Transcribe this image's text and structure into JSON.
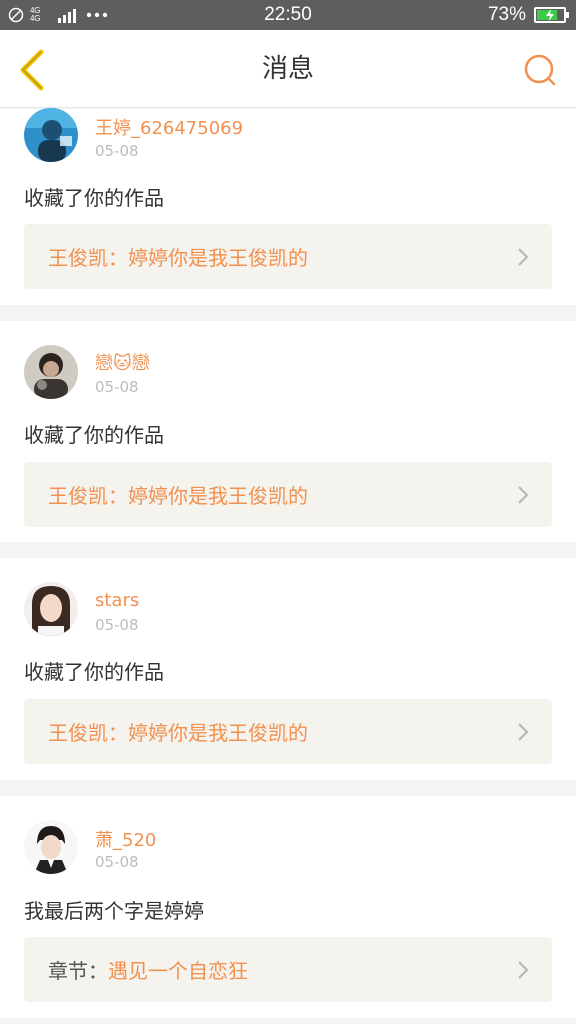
{
  "status_bar": {
    "network": "4G 4G",
    "time": "22:50",
    "battery_percent": "73%",
    "battery_level": 0.73
  },
  "header": {
    "title": "消息"
  },
  "notifications": [
    {
      "user": "王婷_626475069",
      "date": "05-08",
      "action": "收藏了你的作品",
      "quote_prefix": "",
      "quote_text": "王俊凯：婷婷你是我王俊凯的"
    },
    {
      "user": "戀🐱戀",
      "date": "05-08",
      "action": "收藏了你的作品",
      "quote_prefix": "",
      "quote_text": "王俊凯：婷婷你是我王俊凯的"
    },
    {
      "user": "stars",
      "date": "05-08",
      "action": "收藏了你的作品",
      "quote_prefix": "",
      "quote_text": "王俊凯：婷婷你是我王俊凯的"
    },
    {
      "user": "萧_520",
      "date": "05-08",
      "action": "我最后两个字是婷婷",
      "quote_prefix": "章节：",
      "quote_text": "遇见一个自恋狂"
    }
  ],
  "colors": {
    "accent": "#f2914f",
    "back_icon": "#f5c400",
    "status_bar_bg": "#5e5e5e",
    "quote_bg": "#f4f3ee"
  }
}
